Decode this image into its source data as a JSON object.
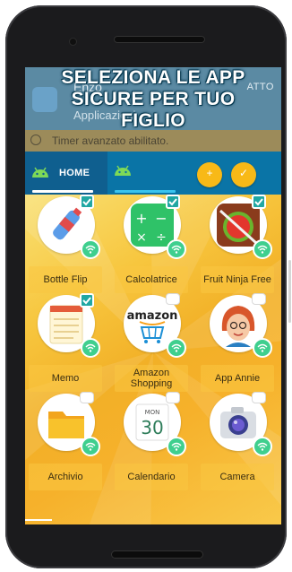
{
  "banner": {
    "line1": "SELEZIONA LE APP",
    "line2": "SICURE PER TUO",
    "line3": "FIGLIO"
  },
  "appbar": {
    "title": "Enzo",
    "subtitle": "Applicazioni",
    "action": "ATTO"
  },
  "timer": {
    "text": "Timer avanzato abilitato."
  },
  "tabs": {
    "home_label": "HOME"
  },
  "fabs": [
    "+",
    "✓"
  ],
  "apps": [
    {
      "name": "Bottle Flip",
      "selected": true
    },
    {
      "name": "Calcolatrice",
      "selected": true
    },
    {
      "name": "Fruit Ninja Free",
      "selected": true
    },
    {
      "name": "Memo",
      "selected": true
    },
    {
      "name": "Amazon Shopping",
      "selected": false
    },
    {
      "name": "App Annie",
      "selected": false
    },
    {
      "name": "Archivio",
      "selected": false
    },
    {
      "name": "Calendario",
      "selected": false
    },
    {
      "name": "Camera",
      "selected": false
    }
  ],
  "icons": {
    "calendar_month": "MON",
    "calendar_day": "30",
    "amazon_word": "amazon"
  },
  "colors": {
    "tabbar": "#0a74a6",
    "check": "#21a7a3",
    "fab": "#f8b917",
    "wifi_badge": "#3fcf8e"
  }
}
